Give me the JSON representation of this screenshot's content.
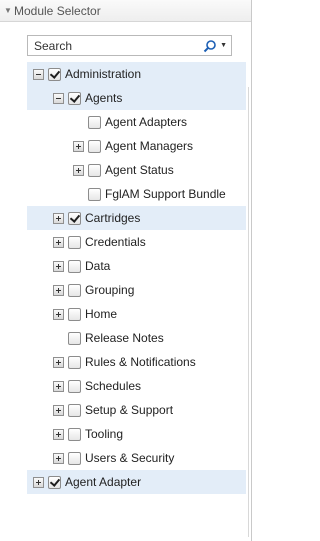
{
  "panel": {
    "title": "Module Selector",
    "search": {
      "placeholder": "Search",
      "value": ""
    }
  },
  "tree": {
    "rows": [
      {
        "label": "Administration",
        "level": 0,
        "expander": "minus",
        "checked": true,
        "selected": true
      },
      {
        "label": "Agents",
        "level": 1,
        "expander": "minus",
        "checked": true,
        "selected": true
      },
      {
        "label": "Agent Adapters",
        "level": 2,
        "expander": "none",
        "checked": false,
        "selected": false
      },
      {
        "label": "Agent Managers",
        "level": 2,
        "expander": "plus",
        "checked": false,
        "selected": false
      },
      {
        "label": "Agent Status",
        "level": 2,
        "expander": "plus",
        "checked": false,
        "selected": false
      },
      {
        "label": "FglAM Support Bundle",
        "level": 2,
        "expander": "none",
        "checked": false,
        "selected": false
      },
      {
        "label": "Cartridges",
        "level": 1,
        "expander": "plus",
        "checked": true,
        "selected": true
      },
      {
        "label": "Credentials",
        "level": 1,
        "expander": "plus",
        "checked": false,
        "selected": false
      },
      {
        "label": "Data",
        "level": 1,
        "expander": "plus",
        "checked": false,
        "selected": false
      },
      {
        "label": "Grouping",
        "level": 1,
        "expander": "plus",
        "checked": false,
        "selected": false
      },
      {
        "label": "Home",
        "level": 1,
        "expander": "plus",
        "checked": false,
        "selected": false
      },
      {
        "label": "Release Notes",
        "level": 1,
        "expander": "none",
        "checked": false,
        "selected": false
      },
      {
        "label": "Rules & Notifications",
        "level": 1,
        "expander": "plus",
        "checked": false,
        "selected": false
      },
      {
        "label": "Schedules",
        "level": 1,
        "expander": "plus",
        "checked": false,
        "selected": false
      },
      {
        "label": "Setup & Support",
        "level": 1,
        "expander": "plus",
        "checked": false,
        "selected": false
      },
      {
        "label": "Tooling",
        "level": 1,
        "expander": "plus",
        "checked": false,
        "selected": false
      },
      {
        "label": "Users & Security",
        "level": 1,
        "expander": "plus",
        "checked": false,
        "selected": false
      },
      {
        "label": "Agent Adapter",
        "level": 0,
        "expander": "plus",
        "checked": true,
        "selected": true
      }
    ]
  },
  "colors": {
    "selected_row": "#e3edf8",
    "border": "#c9c9c9"
  }
}
